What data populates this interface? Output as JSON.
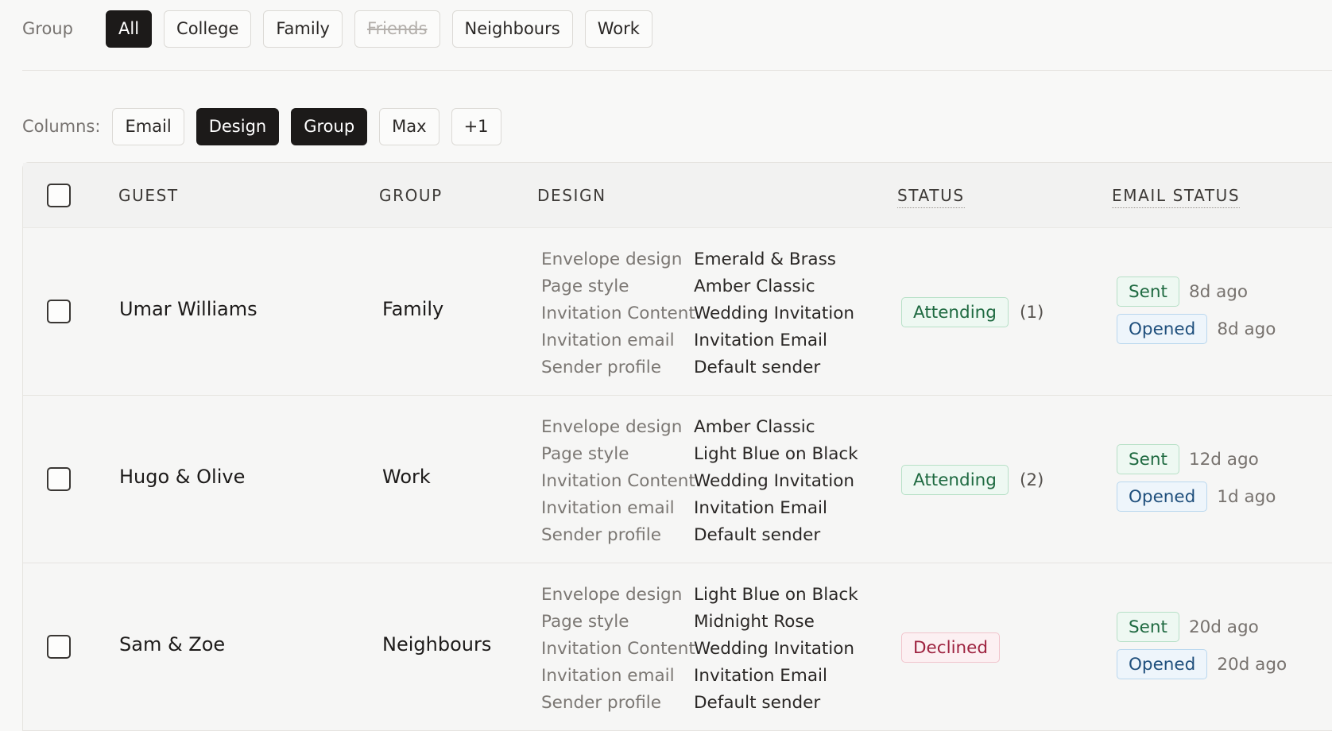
{
  "filters": {
    "group_label": "Group",
    "groups": [
      {
        "label": "All",
        "active": true,
        "struck": false
      },
      {
        "label": "College",
        "active": false,
        "struck": false
      },
      {
        "label": "Family",
        "active": false,
        "struck": false
      },
      {
        "label": "Friends",
        "active": false,
        "struck": true
      },
      {
        "label": "Neighbours",
        "active": false,
        "struck": false
      },
      {
        "label": "Work",
        "active": false,
        "struck": false
      }
    ],
    "columns_label": "Columns:",
    "columns": [
      {
        "label": "Email",
        "active": false
      },
      {
        "label": "Design",
        "active": true
      },
      {
        "label": "Group",
        "active": true
      },
      {
        "label": "Max",
        "active": false
      },
      {
        "label": "+1",
        "active": false
      }
    ]
  },
  "table": {
    "headers": {
      "guest": "GUEST",
      "group": "GROUP",
      "design": "DESIGN",
      "status": "STATUS",
      "email_status": "EMAIL STATUS"
    },
    "design_keys": [
      "Envelope design",
      "Page style",
      "Invitation Content",
      "Invitation email",
      "Sender profile"
    ],
    "rows": [
      {
        "guest": "Umar Williams",
        "group": "Family",
        "design": [
          "Emerald & Brass",
          "Amber Classic",
          "Wedding Invitation",
          "Invitation Email",
          "Default sender"
        ],
        "status": "Attending",
        "status_kind": "attending",
        "count": "(1)",
        "sent_label": "Sent",
        "sent_ago": "8d ago",
        "opened_label": "Opened",
        "opened_ago": "8d ago"
      },
      {
        "guest": "Hugo & Olive",
        "group": "Work",
        "design": [
          "Amber Classic",
          "Light Blue on Black",
          "Wedding Invitation",
          "Invitation Email",
          "Default sender"
        ],
        "status": "Attending",
        "status_kind": "attending",
        "count": "(2)",
        "sent_label": "Sent",
        "sent_ago": "12d ago",
        "opened_label": "Opened",
        "opened_ago": "1d ago"
      },
      {
        "guest": "Sam & Zoe",
        "group": "Neighbours",
        "design": [
          "Light Blue on Black",
          "Midnight Rose",
          "Wedding Invitation",
          "Invitation Email",
          "Default sender"
        ],
        "status": "Declined",
        "status_kind": "declined",
        "count": "",
        "sent_label": "Sent",
        "sent_ago": "20d ago",
        "opened_label": "Opened",
        "opened_ago": "20d ago"
      }
    ]
  }
}
